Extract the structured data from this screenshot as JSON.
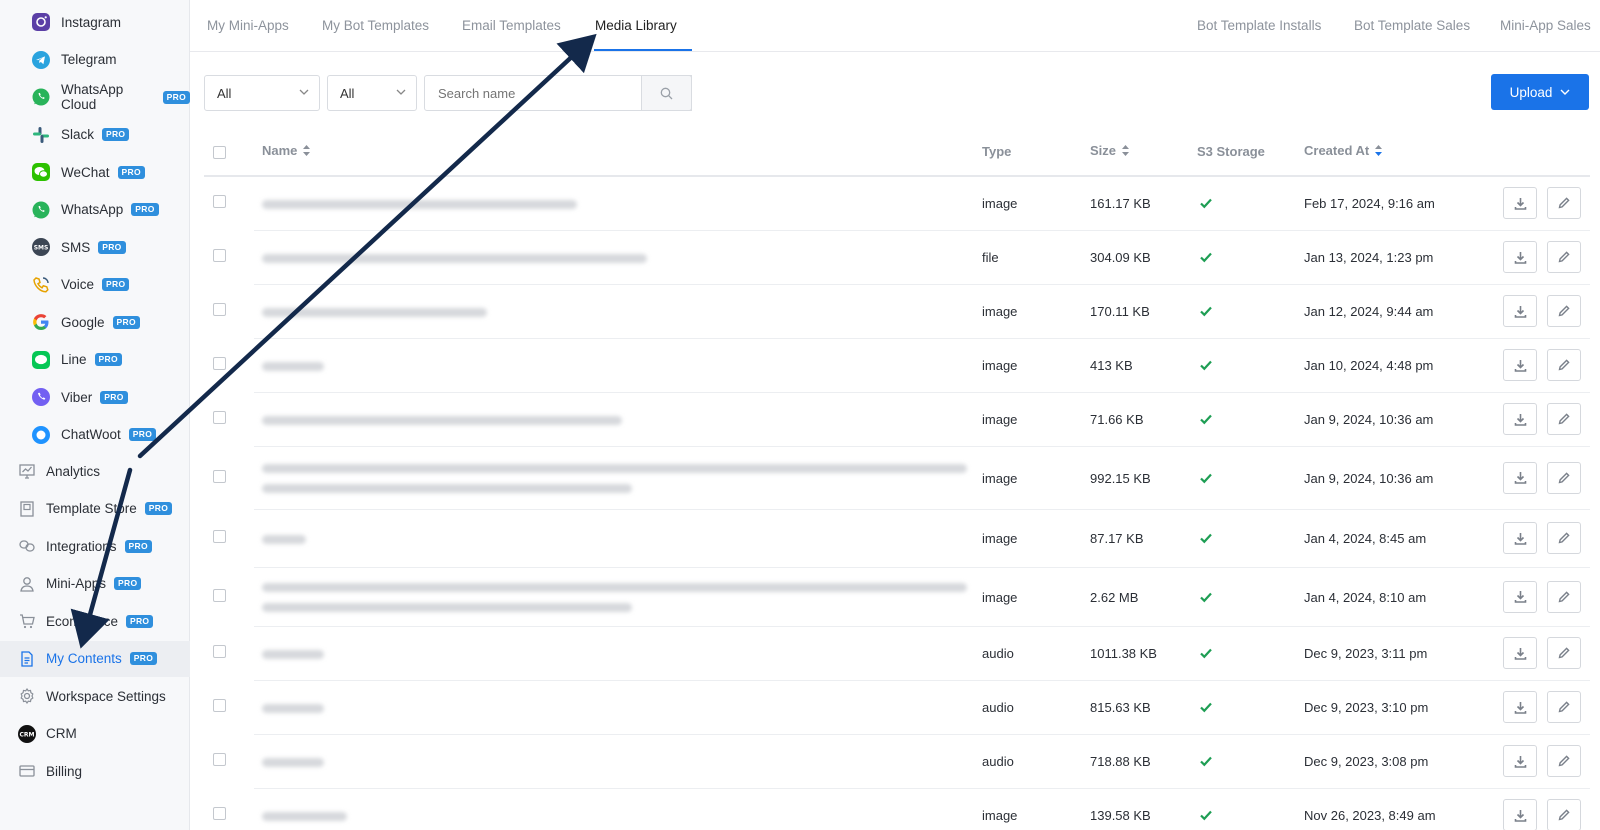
{
  "sidebar": {
    "channels": [
      {
        "label": "Instagram",
        "icon": "instagram-icon",
        "pro": false
      },
      {
        "label": "Telegram",
        "icon": "telegram-icon",
        "pro": false
      },
      {
        "label": "WhatsApp Cloud",
        "icon": "whatsapp-icon",
        "pro": true
      },
      {
        "label": "Slack",
        "icon": "slack-icon",
        "pro": true
      },
      {
        "label": "WeChat",
        "icon": "wechat-icon",
        "pro": true
      },
      {
        "label": "WhatsApp",
        "icon": "whatsapp-icon",
        "pro": true
      },
      {
        "label": "SMS",
        "icon": "sms-icon",
        "pro": true
      },
      {
        "label": "Voice",
        "icon": "phone-icon",
        "pro": true
      },
      {
        "label": "Google",
        "icon": "google-icon",
        "pro": true
      },
      {
        "label": "Line",
        "icon": "line-icon",
        "pro": true
      },
      {
        "label": "Viber",
        "icon": "viber-icon",
        "pro": true
      },
      {
        "label": "ChatWoot",
        "icon": "chatwoot-icon",
        "pro": true
      }
    ],
    "main": [
      {
        "label": "Analytics",
        "icon": "analytics-icon",
        "pro": false
      },
      {
        "label": "Template Store",
        "icon": "store-icon",
        "pro": true
      },
      {
        "label": "Integrations",
        "icon": "integrations-icon",
        "pro": true
      },
      {
        "label": "Mini-Apps",
        "icon": "user-icon",
        "pro": true
      },
      {
        "label": "Ecommerce",
        "icon": "cart-icon",
        "pro": true
      },
      {
        "label": "My Contents",
        "icon": "document-icon",
        "pro": true,
        "active": true
      },
      {
        "label": "Workspace Settings",
        "icon": "gear-icon",
        "pro": false
      },
      {
        "label": "CRM",
        "icon": "crm-icon",
        "pro": false
      },
      {
        "label": "Billing",
        "icon": "card-icon",
        "pro": false
      }
    ],
    "pro_badge": "PRO",
    "crm_badge": "CRM",
    "sms_badge": "SMS"
  },
  "tabs": {
    "left": [
      "My Mini-Apps",
      "My Bot Templates",
      "Email Templates",
      "Media Library"
    ],
    "right": [
      "Bot Template Installs",
      "Bot Template Sales",
      "Mini-App Sales"
    ],
    "active": "Media Library"
  },
  "filters": {
    "select1": "All",
    "select2": "All",
    "search_placeholder": "Search name",
    "upload_label": "Upload"
  },
  "table": {
    "columns": {
      "name": "Name",
      "type": "Type",
      "size": "Size",
      "storage": "S3 Storage",
      "created": "Created At"
    },
    "rows": [
      {
        "type": "image",
        "size": "161.17 KB",
        "created": "Feb 17, 2024, 9:16 am"
      },
      {
        "type": "file",
        "size": "304.09 KB",
        "created": "Jan 13, 2024, 1:23 pm"
      },
      {
        "type": "image",
        "size": "170.11 KB",
        "created": "Jan 12, 2024, 9:44 am"
      },
      {
        "type": "image",
        "size": "413 KB",
        "created": "Jan 10, 2024, 4:48 pm"
      },
      {
        "type": "image",
        "size": "71.66 KB",
        "created": "Jan 9, 2024, 10:36 am"
      },
      {
        "type": "image",
        "size": "992.15 KB",
        "created": "Jan 9, 2024, 10:36 am"
      },
      {
        "type": "image",
        "size": "87.17 KB",
        "created": "Jan 4, 2024, 8:45 am"
      },
      {
        "type": "image",
        "size": "2.62 MB",
        "created": "Jan 4, 2024, 8:10 am"
      },
      {
        "type": "audio",
        "size": "1011.38 KB",
        "created": "Dec 9, 2023, 3:11 pm"
      },
      {
        "type": "audio",
        "size": "815.63 KB",
        "created": "Dec 9, 2023, 3:10 pm"
      },
      {
        "type": "audio",
        "size": "718.88 KB",
        "created": "Dec 9, 2023, 3:08 pm"
      },
      {
        "type": "image",
        "size": "139.58 KB",
        "created": "Nov 26, 2023, 8:49 am"
      }
    ]
  },
  "colors": {
    "accent": "#1a73e8",
    "check": "#1e9e54",
    "arrow": "#13294b"
  }
}
